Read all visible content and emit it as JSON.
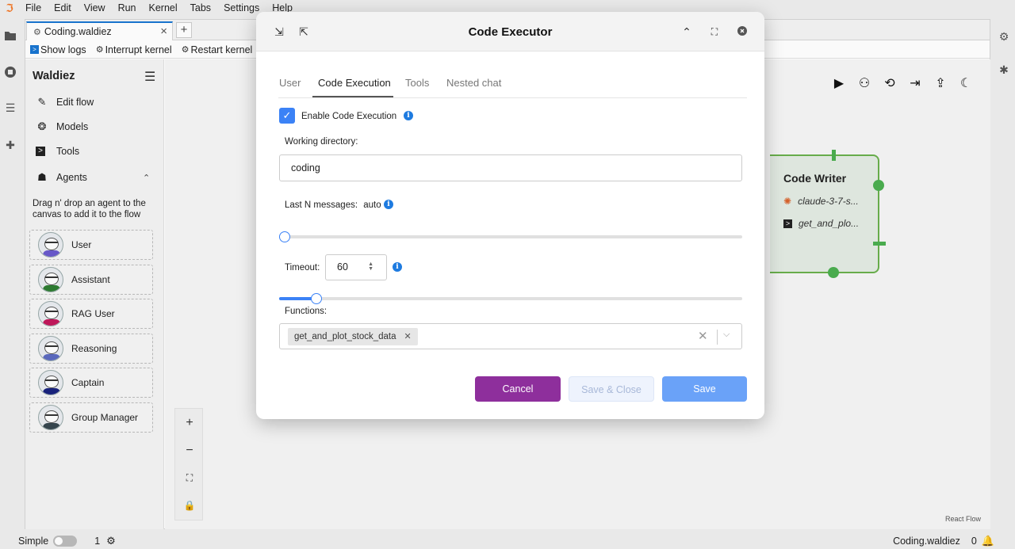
{
  "menubar": {
    "items": [
      "File",
      "Edit",
      "View",
      "Run",
      "Kernel",
      "Tabs",
      "Settings",
      "Help"
    ]
  },
  "tab": {
    "title": "Coding.waldiez",
    "close": "×",
    "add": "+"
  },
  "toolbar": {
    "show_logs": "Show logs",
    "interrupt": "Interrupt kernel",
    "restart": "Restart kernel"
  },
  "sidebar": {
    "title": "Waldiez",
    "items": [
      {
        "label": "Edit flow",
        "icon": "edit-icon"
      },
      {
        "label": "Models",
        "icon": "openai-icon"
      },
      {
        "label": "Tools",
        "icon": "terminal-icon"
      },
      {
        "label": "Agents",
        "icon": "robot-icon"
      }
    ],
    "hint": "Drag n' drop an agent to the canvas to add it to the flow",
    "agents": [
      {
        "name": "User",
        "color": "#6a5acd"
      },
      {
        "name": "Assistant",
        "color": "#2e7d32"
      },
      {
        "name": "RAG User",
        "color": "#c2185b"
      },
      {
        "name": "Reasoning",
        "color": "#5c6bc0"
      },
      {
        "name": "Captain",
        "color": "#1a237e"
      },
      {
        "name": "Group Manager",
        "color": "#37474f"
      }
    ]
  },
  "canvas": {
    "react_flow": "React Flow",
    "node": {
      "title": "Code Writer",
      "model": "claude-3-7-s...",
      "tool": "get_and_plo..."
    }
  },
  "statusbar": {
    "mode": "Simple",
    "count": "1",
    "file": "Coding.waldiez",
    "notifications": "0"
  },
  "dialog": {
    "title": "Code Executor",
    "tabs": [
      "User",
      "Code Execution",
      "Tools",
      "Nested chat"
    ],
    "enable_label": "Enable Code Execution",
    "workdir_label": "Working directory:",
    "workdir_value": "coding",
    "last_n_label": "Last N messages:",
    "last_n_value": "auto",
    "last_n_fraction": 0,
    "timeout_label": "Timeout:",
    "timeout_value": "60",
    "timeout_fraction": 0.07,
    "functions_label": "Functions:",
    "functions_selected": "get_and_plot_stock_data",
    "buttons": {
      "cancel": "Cancel",
      "save_close": "Save & Close",
      "save": "Save"
    }
  },
  "colors": {
    "accent": "#3b82f6",
    "cancel": "#8e2f9c",
    "node_border": "#6ab04c"
  }
}
